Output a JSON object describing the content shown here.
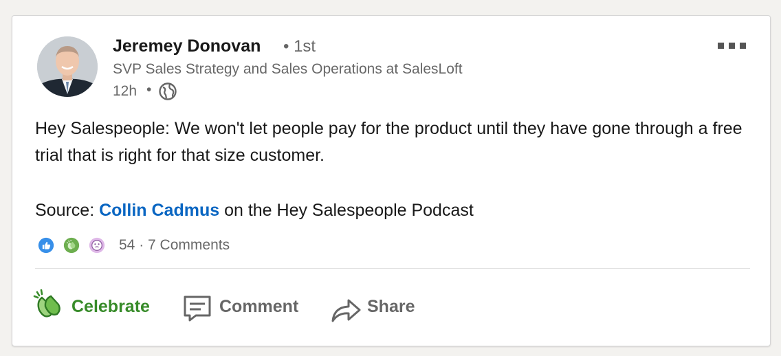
{
  "post": {
    "author": {
      "name": "Jeremey Donovan",
      "degree": "• 1st",
      "headline": "SVP Sales Strategy and Sales Operations at SalesLoft",
      "timestamp": "12h",
      "separator": "•",
      "visibility_icon": "globe-icon"
    },
    "menu_icon": "more-options-icon",
    "body": "Hey Salespeople: We won't let people pay for the product until they have gone through a free trial that is right for that size customer.",
    "source": {
      "prefix": "Source: ",
      "mention": "Collin Cadmus",
      "suffix": " on the Hey Salespeople Podcast"
    },
    "social_counts": {
      "reactions": "54",
      "separator": "·",
      "comments": "7 Comments",
      "reaction_icons": [
        "like-icon",
        "celebrate-icon",
        "curious-icon"
      ]
    },
    "actions": {
      "celebrate": "Celebrate",
      "comment": "Comment",
      "share": "Share"
    },
    "colors": {
      "link": "#0a66c2",
      "celebrate": "#378b29",
      "like": "#378fe9",
      "curious": "#dfb8e8"
    }
  }
}
